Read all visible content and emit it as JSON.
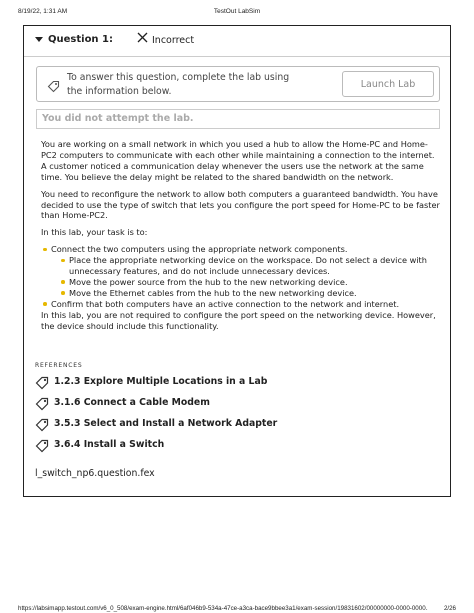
{
  "print": {
    "datetime": "8/19/22, 1:31 AM",
    "title": "TestOut LabSim",
    "url": "https://labsimapp.testout.com/v6_0_508/exam-engine.html/6af046b9-534a-47ce-a3ca-bace9bbee3a1/exam-session/19831602/00000000-0000-0000...",
    "page": "2/26"
  },
  "question": {
    "title": "Question 1:",
    "status": "Incorrect",
    "status_icon": "x-icon"
  },
  "lab": {
    "instruction": "To answer this question, complete the lab using the information below.",
    "launch_label": "Launch Lab",
    "result": "You did not attempt the lab."
  },
  "content": {
    "p1": "You are working on a small network in which you used a hub to allow the Home-PC and Home-PC2 computers to communicate with each other while maintaining a connection to the internet. A customer noticed a communication delay whenever the users use the network at the same time. You believe the delay might be related to the shared bandwidth on the network.",
    "p2": "You need to reconfigure the network to allow both computers a guaranteed bandwidth. You have decided to use the type of switch that lets you configure the port speed for Home-PC to be faster than Home-PC2.",
    "p3": "In this lab, your task is to:",
    "task1": "Connect the two computers using the appropriate network components.",
    "sub1": "Place the appropriate networking device on the workspace. Do not select a device with unnecessary features, and do not include unnecessary devices.",
    "sub2": "Move the power source from the hub to the new networking device.",
    "sub3": "Move the Ethernet cables from the hub to the new networking device.",
    "task2": "Confirm that both computers have an active connection to the network and internet.",
    "note": "In this lab, you are not required to configure the port speed on the networking device. However, the device should include this functionality."
  },
  "references": {
    "title": "REFERENCES",
    "items": [
      "1.2.3 Explore Multiple Locations in a Lab",
      "3.1.6 Connect a Cable Modem",
      "3.5.3 Select and Install a Network Adapter",
      "3.6.4 Install a Switch"
    ]
  },
  "filename": "l_switch_np6.question.fex"
}
